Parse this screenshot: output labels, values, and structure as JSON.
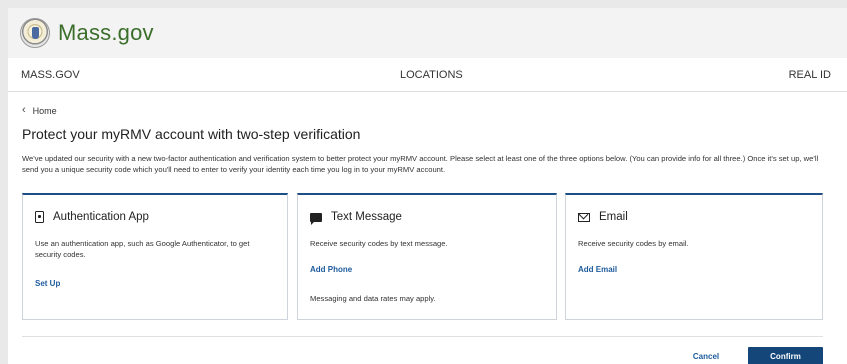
{
  "header": {
    "brand": "Mass.gov",
    "nav": [
      "MASS.GOV",
      "LOCATIONS",
      "REAL ID"
    ]
  },
  "breadcrumb": {
    "label": "Home"
  },
  "page": {
    "title": "Protect your myRMV account with two-step verification",
    "intro": "We've updated our security with a new two-factor authentication and verification system to better protect your myRMV account. Please select at least one of the three options below. (You can provide info for all three.) Once it's set up, we'll send you a unique security code which you'll need to enter to verify your identity each time you log in to your myRMV account."
  },
  "cards": [
    {
      "icon": "phone-icon",
      "title": "Authentication App",
      "description": "Use an authentication app, such as Google Authenticator, to get security codes.",
      "link": "Set Up"
    },
    {
      "icon": "chat-icon",
      "title": "Text Message",
      "description": "Receive security codes by text message.",
      "link": "Add Phone",
      "note": "Messaging and data rates may apply."
    },
    {
      "icon": "mail-icon",
      "title": "Email",
      "description": "Receive security codes by email.",
      "link": "Add Email"
    }
  ],
  "actions": {
    "cancel": "Cancel",
    "confirm": "Confirm"
  },
  "colors": {
    "brand_green": "#3b6e2b",
    "accent_blue": "#1d4f86",
    "link_blue": "#1d5b9c",
    "button_blue": "#14467a"
  }
}
